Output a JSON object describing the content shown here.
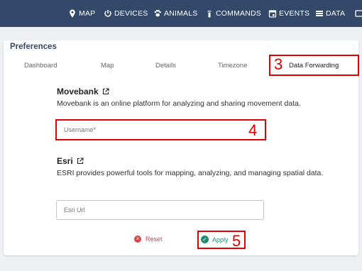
{
  "nav": {
    "map": "MAP",
    "devices": "DEVICES",
    "animals": "ANIMALS",
    "commands": "COMMANDS",
    "events": "EVENTS",
    "data": "DATA"
  },
  "card": {
    "title": "Preferences"
  },
  "tabs": {
    "dashboard": "Dashboard",
    "map": "Map",
    "details": "Details",
    "timezone": "Timezone",
    "forwarding": "Data Forwarding",
    "active": "Data Forwarding"
  },
  "movebank": {
    "title": "Movebank",
    "description": "Movebank is an online platform for analyzing and sharing movement data.",
    "username_placeholder": "Username*"
  },
  "esri": {
    "title": "Esri",
    "description": "ESRI provides powerful tools for mapping, analyzing, and managing spatial data.",
    "url_placeholder": "Esri Url"
  },
  "actions": {
    "reset": "Reset",
    "apply": "Apply"
  },
  "annotations": {
    "three": "3",
    "four": "4",
    "five": "5"
  },
  "colors": {
    "topbar": "#34496a",
    "highlight": "#e00000",
    "reset": "#d64545",
    "apply": "#1f8a70"
  }
}
